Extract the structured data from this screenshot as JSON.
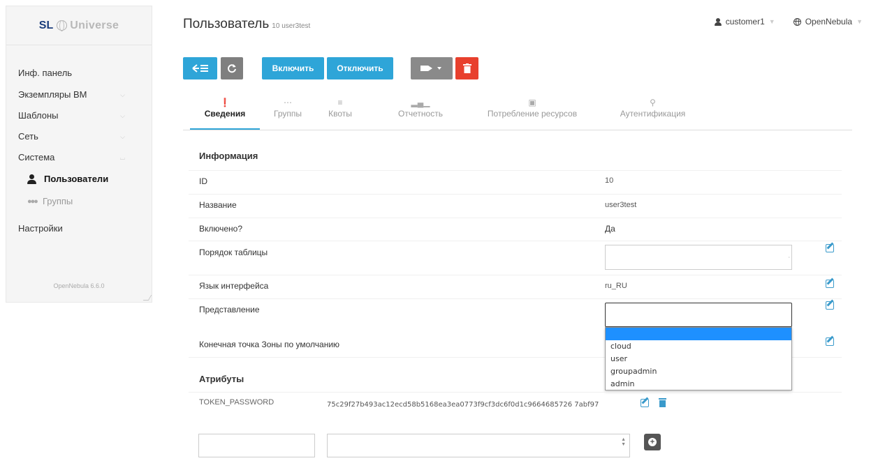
{
  "sidebar": {
    "logo_sl": "SL",
    "logo_text": "Universe",
    "items": [
      {
        "label": "Инф. панель"
      },
      {
        "label": "Экземпляры ВМ"
      },
      {
        "label": "Шаблоны"
      },
      {
        "label": "Сеть"
      },
      {
        "label": "Система"
      }
    ],
    "sub_items": [
      {
        "label": "Пользователи",
        "icon": "user-icon"
      },
      {
        "label": "Группы",
        "icon": "users-icon"
      }
    ],
    "settings": "Настройки",
    "version": "OpenNebula 6.6.0"
  },
  "header": {
    "title": "Пользователь",
    "subtitle": "10 user3test",
    "user": "customer1",
    "zone": "OpenNebula"
  },
  "toolbar": {
    "enable": "Включить",
    "disable": "Отключить"
  },
  "tabs": [
    {
      "label": "Сведения",
      "icon": "info-icon"
    },
    {
      "label": "Группы",
      "icon": "users-icon"
    },
    {
      "label": "Квоты",
      "icon": "list-icon"
    },
    {
      "label": "Отчетность",
      "icon": "bar-chart-icon"
    },
    {
      "label": "Потребление ресурсов",
      "icon": "server-icon"
    },
    {
      "label": "Аутентификация",
      "icon": "key-icon"
    }
  ],
  "info": {
    "heading": "Информация",
    "rows": [
      {
        "label": "ID",
        "value": "10"
      },
      {
        "label": "Название",
        "value": "user3test"
      },
      {
        "label": "Включено?",
        "value": "Да"
      },
      {
        "label": "Порядок таблицы",
        "value": ""
      },
      {
        "label": "Язык интерфейса",
        "value": "ru_RU"
      },
      {
        "label": "Представление",
        "value": ""
      },
      {
        "label": "Конечная точка Зоны по умолчанию",
        "value": ""
      }
    ]
  },
  "view_dropdown": {
    "options": [
      "",
      "cloud",
      "user",
      "groupadmin",
      "admin"
    ]
  },
  "attributes": {
    "heading": "Атрибуты",
    "rows": [
      {
        "key": "TOKEN_PASSWORD",
        "value": "75c29f27b493ac12ecd58b5168ea3ea0773f9cf3dc6f0d1c9664685726 7abf97"
      }
    ]
  }
}
